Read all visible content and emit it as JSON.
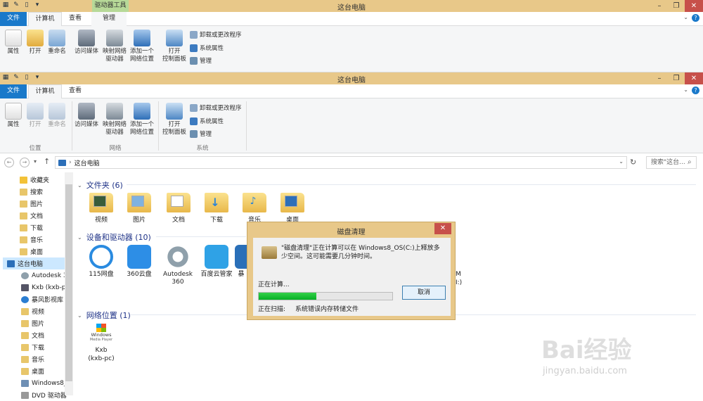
{
  "top_window": {
    "title": "这台电脑",
    "context_tab_label": "驱动器工具",
    "tabs": [
      "文件",
      "计算机",
      "查看",
      "管理"
    ],
    "buttons": [
      "属性",
      "打开",
      "重命名",
      "访问媒体",
      "映射网络",
      "驱动器",
      "添加一个",
      "网络位置",
      "打开",
      "控制面板"
    ],
    "small": [
      "卸载或更改程序",
      "系统属性",
      "管理"
    ]
  },
  "window": {
    "title": "这台电脑",
    "tabs": [
      "文件",
      "计算机",
      "查看"
    ],
    "ribbon": {
      "props": "属性",
      "open": "打开",
      "rename": "重命名",
      "media": "访问媒体",
      "map1": "映射网络",
      "map2": "驱动器",
      "add1": "添加一个",
      "add2": "网络位置",
      "cp1": "打开",
      "cp2": "控制面板",
      "uninstall": "卸载或更改程序",
      "sysprops": "系统属性",
      "manage": "管理",
      "group_location": "位置",
      "group_network": "网络",
      "group_system": "系统"
    }
  },
  "address": {
    "path": "这台电脑",
    "search_placeholder": "搜索\"这台..."
  },
  "nav": [
    "收藏夹",
    "搜索",
    "图片",
    "文档",
    "下载",
    "音乐",
    "桌面",
    "这台电脑",
    "Autodesk 3",
    "Kxb (kxb-p",
    "暴风影视库",
    "视频",
    "图片",
    "文档",
    "下载",
    "音乐",
    "桌面",
    "Windows8_",
    "DVD 驱动器"
  ],
  "sections": {
    "folders": "文件夹 (6)",
    "devices": "设备和驱动器 (10)",
    "network": "网络位置 (1)"
  },
  "folders": [
    "视频",
    "图片",
    "文档",
    "下载",
    "音乐",
    "桌面"
  ],
  "devices": [
    {
      "name": "115网盘",
      "color": "#2a8be0"
    },
    {
      "name": "360云盘",
      "color": "#2d8ee6"
    },
    {
      "name": "Autodesk 360",
      "color": "#8fa0ab"
    },
    {
      "name": "百度云管家",
      "color": "#2fa2e6"
    },
    {
      "name": "暴",
      "color": "#2a6fb8"
    }
  ],
  "device_partial": [
    "M",
    "I:)"
  ],
  "network_item": {
    "name": "Kxb",
    "sub": "(kxb-pc)",
    "logo1": "Windows",
    "logo2": "Media Player"
  },
  "dialog": {
    "title": "磁盘清理",
    "message": "\"磁盘清理\"正在计算可以在 Windows8_OS(C:)上释放多少空间。这可能需要几分钟时间。",
    "calculating": "正在计算...",
    "progress": 0.43,
    "cancel": "取消",
    "scanning_label": "正在扫描:",
    "scanning_item": "系统错误内存转储文件"
  },
  "watermark": {
    "main": "Bai经验",
    "sub": "jingyan.baidu.com"
  }
}
